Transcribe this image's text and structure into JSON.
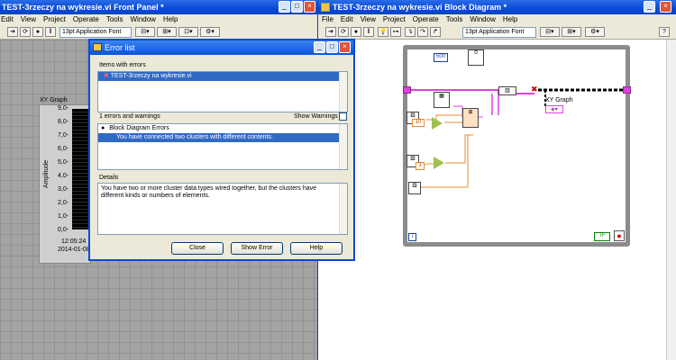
{
  "front_panel": {
    "title": "TEST-3rzeczy na wykresie.vi Front Panel *",
    "menu": [
      "Edit",
      "View",
      "Project",
      "Operate",
      "Tools",
      "Window",
      "Help"
    ],
    "font": "13pt Application Font",
    "graph": {
      "label": "XY Graph",
      "y_axis_label": "Amplitude",
      "y_ticks": [
        "9,0-",
        "8,0-",
        "7,0-",
        "6,0-",
        "5,0-",
        "4,0-",
        "3,0-",
        "2,0-",
        "1,0-",
        "0,0-"
      ],
      "x_time": "12:05:24",
      "x_date": "2014-01-08"
    }
  },
  "block_diagram": {
    "title": "TEST-3rzeczy na wykresie.vi Block Diagram *",
    "menu": [
      "File",
      "Edit",
      "View",
      "Project",
      "Operate",
      "Tools",
      "Window",
      "Help"
    ],
    "font": "13pt Application Font",
    "const_500": "500",
    "const_10": "10",
    "const_3": "3",
    "graph_label": "XY Graph",
    "loop_index": "i"
  },
  "dialog": {
    "title": "Error list",
    "items_label": "Items with errors",
    "items": [
      "TEST-3rzeczy na wykresie.vi"
    ],
    "count_text": "1 errors and warnings",
    "show_warnings": "Show Warnings",
    "tree_group": "Block Diagram Errors",
    "tree_item": "You have connected two clusters with different contents.",
    "details_label": "Details",
    "details_text": "You have two or more cluster data types wired together, but the clusters have different kinds or numbers of elements.",
    "buttons": {
      "close": "Close",
      "show_error": "Show Error",
      "help": "Help"
    }
  }
}
